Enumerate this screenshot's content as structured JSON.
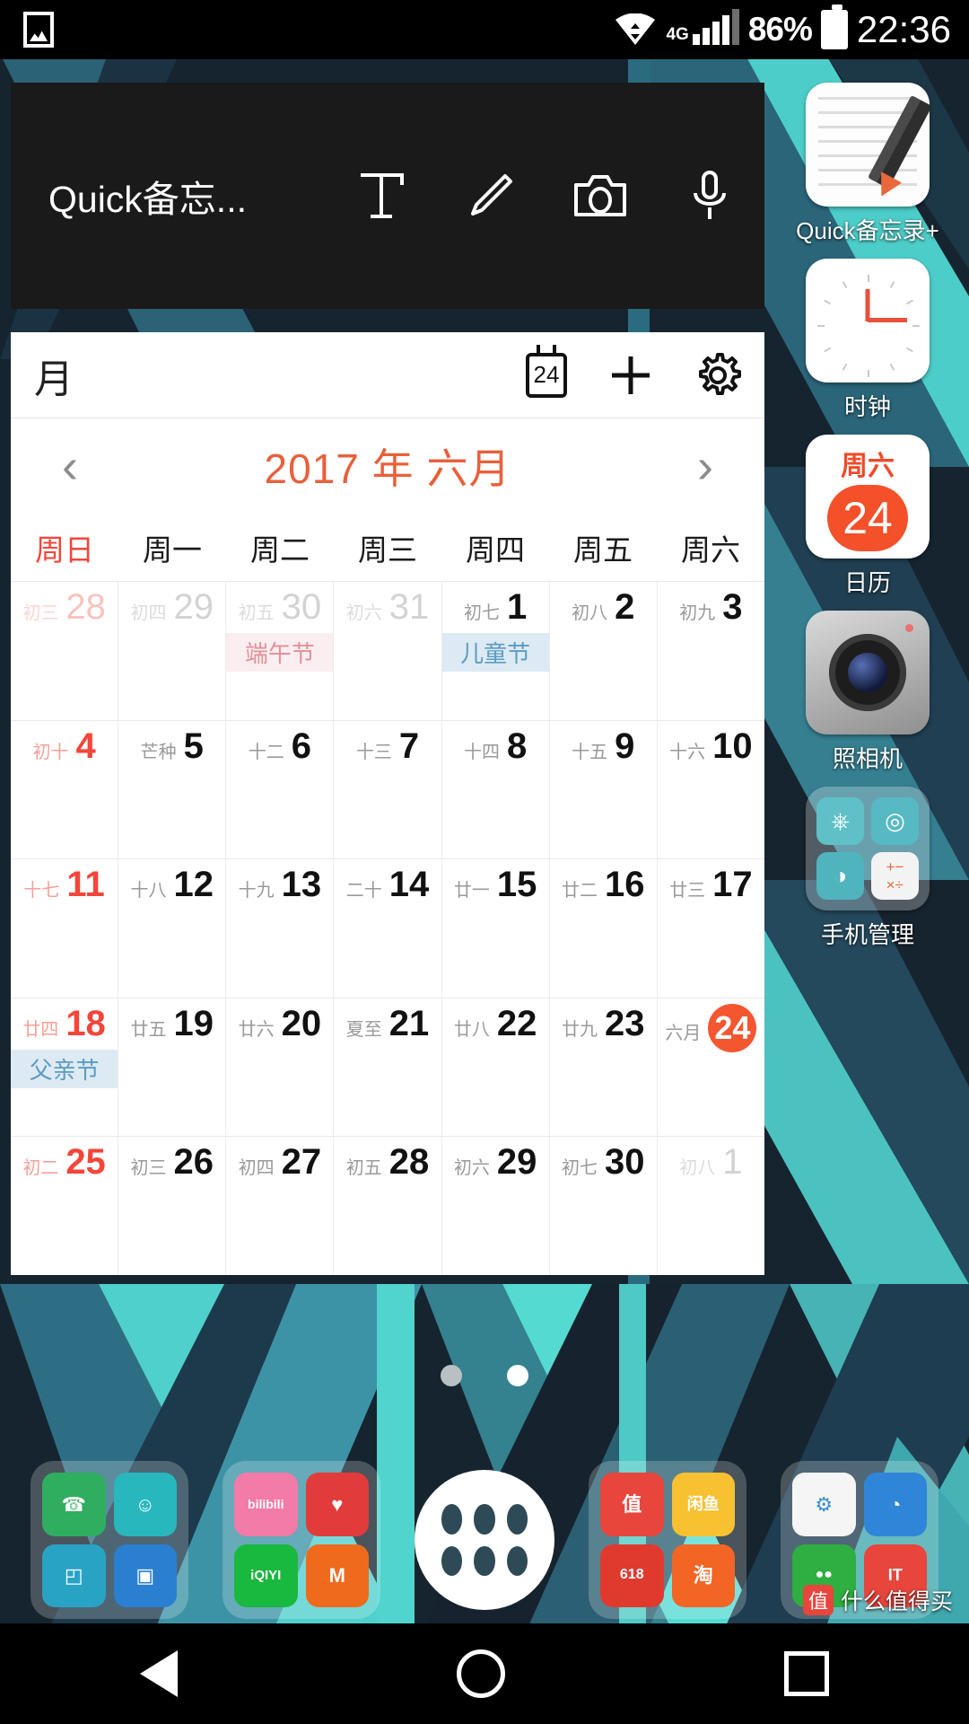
{
  "statusbar": {
    "image_icon": "image-icon",
    "wifi_icon": "wifi-icon",
    "network_label": "4G",
    "battery_percent": "86%",
    "time": "22:36"
  },
  "memo_widget": {
    "title": "Quick备忘...",
    "tools": [
      {
        "name": "text-tool",
        "glyph": "T"
      },
      {
        "name": "pen-tool",
        "glyph": "pencil-icon"
      },
      {
        "name": "camera-tool",
        "glyph": "camera-icon"
      },
      {
        "name": "mic-tool",
        "glyph": "microphone-icon"
      }
    ]
  },
  "calendar_widget": {
    "view_label": "月",
    "today_icon_label": "24",
    "add_label": "+",
    "settings_label": "gear-icon",
    "prev_label": "‹",
    "next_label": "›",
    "title": "2017 年 六月",
    "title_color": "#e8603c",
    "today_color": "#f4562f",
    "weekdays": [
      "周日",
      "周一",
      "周二",
      "周三",
      "周四",
      "周五",
      "周六"
    ],
    "weeks": [
      [
        {
          "lunar": "初三",
          "day": "28",
          "out": true,
          "sun": true
        },
        {
          "lunar": "初四",
          "day": "29",
          "out": true
        },
        {
          "lunar": "初五",
          "day": "30",
          "out": true,
          "festival": "端午节",
          "festival_style": "pink"
        },
        {
          "lunar": "初六",
          "day": "31",
          "out": true
        },
        {
          "lunar": "初七",
          "day": "1",
          "festival": "儿童节",
          "festival_style": "blue"
        },
        {
          "lunar": "初八",
          "day": "2"
        },
        {
          "lunar": "初九",
          "day": "3"
        }
      ],
      [
        {
          "lunar": "初十",
          "day": "4",
          "sun": true
        },
        {
          "lunar": "芒种",
          "day": "5"
        },
        {
          "lunar": "十二",
          "day": "6"
        },
        {
          "lunar": "十三",
          "day": "7"
        },
        {
          "lunar": "十四",
          "day": "8"
        },
        {
          "lunar": "十五",
          "day": "9"
        },
        {
          "lunar": "十六",
          "day": "10"
        }
      ],
      [
        {
          "lunar": "十七",
          "day": "11",
          "sun": true
        },
        {
          "lunar": "十八",
          "day": "12"
        },
        {
          "lunar": "十九",
          "day": "13"
        },
        {
          "lunar": "二十",
          "day": "14"
        },
        {
          "lunar": "廿一",
          "day": "15"
        },
        {
          "lunar": "廿二",
          "day": "16"
        },
        {
          "lunar": "廿三",
          "day": "17"
        }
      ],
      [
        {
          "lunar": "廿四",
          "day": "18",
          "sun": true,
          "festival": "父亲节",
          "festival_style": "blue"
        },
        {
          "lunar": "廿五",
          "day": "19"
        },
        {
          "lunar": "廿六",
          "day": "20"
        },
        {
          "lunar": "夏至",
          "day": "21"
        },
        {
          "lunar": "廿八",
          "day": "22"
        },
        {
          "lunar": "廿九",
          "day": "23"
        },
        {
          "lunar": "六月",
          "day": "24",
          "today": true
        }
      ],
      [
        {
          "lunar": "初二",
          "day": "25",
          "sun": true
        },
        {
          "lunar": "初三",
          "day": "26"
        },
        {
          "lunar": "初四",
          "day": "27"
        },
        {
          "lunar": "初五",
          "day": "28"
        },
        {
          "lunar": "初六",
          "day": "29"
        },
        {
          "lunar": "初七",
          "day": "30"
        },
        {
          "lunar": "初八",
          "day": "1",
          "out": true
        }
      ]
    ]
  },
  "app_column": [
    {
      "name": "quick-memo-plus",
      "label": "Quick备忘录+",
      "icon": "notepad-pencil-icon"
    },
    {
      "name": "clock",
      "label": "时钟",
      "icon": "analog-clock-icon"
    },
    {
      "name": "calendar",
      "label": "日历",
      "icon": "calendar-date-icon",
      "dow": "周六",
      "date": "24"
    },
    {
      "name": "camera",
      "label": "照相机",
      "icon": "camera-lens-icon"
    },
    {
      "name": "phone-manager",
      "label": "手机管理",
      "icon": "folder-icon",
      "minis": [
        {
          "name": "leaf-icon",
          "glyph": "⎋",
          "color": "#5fc0c7"
        },
        {
          "name": "shield-icon",
          "glyph": "◎",
          "color": "#57b9c4"
        },
        {
          "name": "contrast-icon",
          "glyph": "◑",
          "color": "#4fb4bd"
        },
        {
          "name": "calculator-icon",
          "glyph": "+−\n×÷",
          "color": "#f3f3f3"
        }
      ]
    }
  ],
  "page_dots": {
    "count": 2,
    "active_index": 1
  },
  "dock": [
    {
      "name": "dock-folder-communication",
      "minis": [
        {
          "name": "phone-icon",
          "glyph": "☎",
          "color": "#2fae60"
        },
        {
          "name": "contacts-icon",
          "glyph": "☺",
          "color": "#28b7bd"
        },
        {
          "name": "gallery-icon",
          "glyph": "◰",
          "color": "#29a3c4"
        },
        {
          "name": "file-manager-icon",
          "glyph": "▣",
          "color": "#2b7fd1"
        }
      ]
    },
    {
      "name": "dock-folder-video",
      "minis": [
        {
          "name": "bilibili-icon",
          "glyph": "bilibili",
          "color": "#f27ba8"
        },
        {
          "name": "kuaikan-icon",
          "glyph": "♥",
          "color": "#e23b3b"
        },
        {
          "name": "iqiyi-icon",
          "glyph": "iQIYI",
          "color": "#19b83e"
        },
        {
          "name": "mango-tv-icon",
          "glyph": "M",
          "color": "#f06a1e"
        }
      ]
    },
    {
      "name": "app-drawer-button",
      "label": "app-drawer-icon"
    },
    {
      "name": "dock-folder-shopping",
      "minis": [
        {
          "name": "smzdm-icon",
          "glyph": "值",
          "color": "#e8453c"
        },
        {
          "name": "xianyu-icon",
          "glyph": "闲鱼",
          "color": "#f7c132"
        },
        {
          "name": "jd-icon",
          "glyph": "618",
          "color": "#e03a2f"
        },
        {
          "name": "taobao-icon",
          "glyph": "淘",
          "color": "#f26524"
        }
      ]
    },
    {
      "name": "dock-folder-social",
      "minis": [
        {
          "name": "settings-icon",
          "glyph": "⚙",
          "color": "#f5f5f5"
        },
        {
          "name": "browser-icon",
          "glyph": "◔",
          "color": "#2f86d8"
        },
        {
          "name": "wechat-icon",
          "glyph": "●●",
          "color": "#2fae41"
        },
        {
          "name": "it-icon",
          "glyph": "IT",
          "color": "#e8453c"
        }
      ]
    }
  ],
  "navbar": {
    "back": "back-triangle-icon",
    "home": "home-circle-icon",
    "recents": "recents-square-icon"
  },
  "watermark": {
    "badge": "值",
    "text": "什么值得买"
  }
}
